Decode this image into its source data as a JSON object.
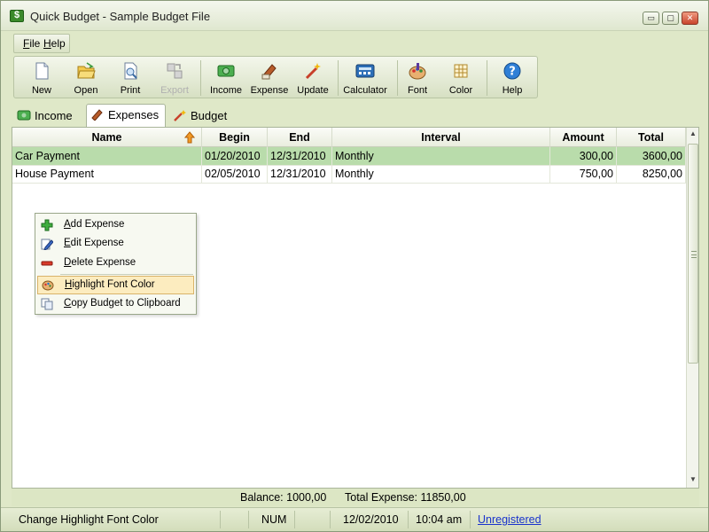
{
  "window": {
    "title": "Quick Budget - Sample Budget File",
    "buttons": {
      "minimize": "▭",
      "maximize": "▢",
      "close": "✕"
    }
  },
  "menu": [
    {
      "label": "File"
    },
    {
      "label": "Help"
    }
  ],
  "toolbar": {
    "new": "New",
    "open": "Open",
    "print": "Print",
    "export": "Export",
    "income": "Income",
    "expense": "Expense",
    "update": "Update",
    "calculator": "Calculator",
    "font": "Font",
    "color": "Color",
    "help": "Help"
  },
  "tabs": [
    {
      "label": "Income",
      "icon": "money-icon"
    },
    {
      "label": "Expenses",
      "icon": "expense-icon"
    },
    {
      "label": "Budget",
      "icon": "wand-icon"
    }
  ],
  "table": {
    "columns": [
      "Name",
      "Begin",
      "End",
      "Interval",
      "Amount",
      "Total"
    ],
    "rows": [
      {
        "name": "Car Payment",
        "begin": "01/20/2010",
        "end": "12/31/2010",
        "interval": "Monthly",
        "amount": "300,00",
        "total": "3600,00",
        "selected": true
      },
      {
        "name": "House Payment",
        "begin": "02/05/2010",
        "end": "12/31/2010",
        "interval": "Monthly",
        "amount": "750,00",
        "total": "8250,00",
        "selected": false
      }
    ]
  },
  "context_menu": {
    "items": [
      {
        "label": "Add Expense",
        "icon": "plus-icon"
      },
      {
        "label": "Edit Expense",
        "icon": "edit-icon"
      },
      {
        "label": "Delete Expense",
        "icon": "minus-icon"
      },
      {
        "label": "Highlight Font Color",
        "icon": "palette-icon",
        "highlighted": true
      },
      {
        "label": "Copy Budget to Clipboard",
        "icon": "copy-icon"
      }
    ]
  },
  "summary": {
    "balance": "Balance: 1000,00",
    "total_expense": "Total Expense: 11850,00"
  },
  "status": {
    "message": "Change Highlight Font Color",
    "num": "NUM",
    "date": "12/02/2010",
    "time": "10:04 am",
    "registration": "Unregistered"
  },
  "colors": {
    "selected_row": "#b9dcab",
    "highlight_item": "#fcecbf",
    "link": "#1a33cc"
  }
}
